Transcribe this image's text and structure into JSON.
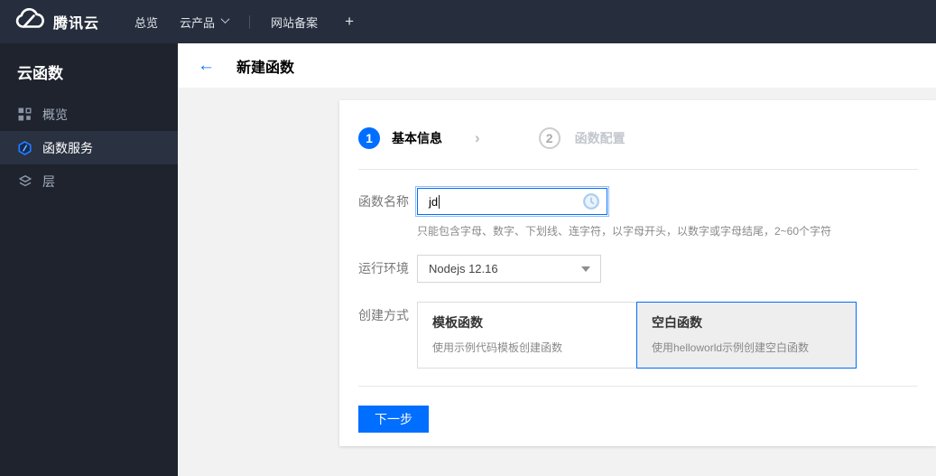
{
  "colors": {
    "accent": "#006eff",
    "navbar_bg": "#262e3d",
    "sidebar_bg": "#1e232e",
    "sidebar_active_bg": "#2a3140",
    "content_bg": "#f2f2f2",
    "selected_card_bg": "#eeeeee"
  },
  "navbar": {
    "brand": "腾讯云",
    "items": [
      {
        "label": "总览"
      },
      {
        "label": "云产品"
      },
      {
        "label": "网站备案"
      },
      {
        "label": "+"
      }
    ]
  },
  "sidebar": {
    "title": "云函数",
    "items": [
      {
        "label": "概览",
        "icon": "grid-icon",
        "active": false
      },
      {
        "label": "函数服务",
        "icon": "function-service-icon",
        "active": true
      },
      {
        "label": "层",
        "icon": "layers-icon",
        "active": false
      }
    ]
  },
  "header": {
    "back_glyph": "←",
    "title": "新建函数"
  },
  "wizard": {
    "separator": "›",
    "steps": [
      {
        "number": "1",
        "label": "基本信息",
        "active": true
      },
      {
        "number": "2",
        "label": "函数配置",
        "active": false
      }
    ]
  },
  "form": {
    "name": {
      "label": "函数名称",
      "value": "jd",
      "status_icon": "clock-icon",
      "help": "只能包含字母、数字、下划线、连字符，以字母开头，以数字或字母结尾，2~60个字符"
    },
    "runtime": {
      "label": "运行环境",
      "value": "Nodejs 12.16"
    },
    "method": {
      "label": "创建方式",
      "options": [
        {
          "title": "模板函数",
          "desc": "使用示例代码模板创建函数",
          "selected": false
        },
        {
          "title": "空白函数",
          "desc": "使用helloworld示例创建空白函数",
          "selected": true
        }
      ]
    }
  },
  "footer": {
    "next": "下一步"
  }
}
